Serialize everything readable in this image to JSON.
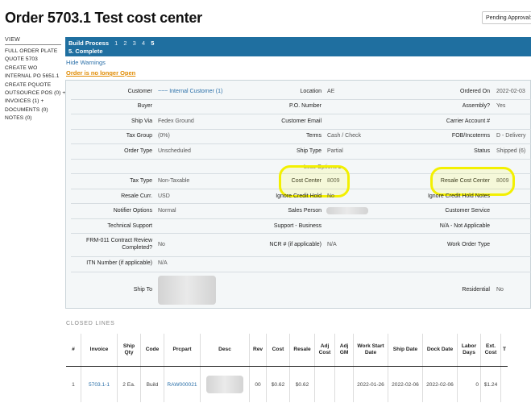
{
  "page_title": "Order 5703.1 Test cost center",
  "pending_approval": "Pending Approval:",
  "nav": {
    "view_label": "VIEW",
    "items": [
      "FULL ORDER PLATE",
      "QUOTE 5703",
      "CREATE WO",
      "INTERNAL PO 5651.1",
      "CREATE PQUOTE",
      "OUTSOURCE POS (0) +",
      "INVOICES (1) +",
      "DOCUMENTS (0)",
      "NOTES (0)"
    ]
  },
  "build_process": {
    "label": "Build Process",
    "steps": [
      "1",
      "2",
      "3",
      "4",
      "5"
    ],
    "active_step": "5",
    "current": "5. Complete",
    "color": "#1f6fa0"
  },
  "hide_warnings": "Hide Warnings",
  "warning_order_closed": "Order is no longer Open",
  "fields": {
    "customer_label": "Customer",
    "customer_value": "~~~ Internal Customer (1)",
    "location_label": "Location",
    "location_value": "AE",
    "ordered_on_label": "Ordered On",
    "ordered_on_value": "2022-02-03",
    "buyer_label": "Buyer",
    "po_number_label": "P.O. Number",
    "assembly_label": "Assembly?",
    "assembly_value": "Yes",
    "ship_via_label": "Ship Via",
    "ship_via_value": "Fedex Ground",
    "customer_email_label": "Customer Email",
    "carrier_account_label": "Carrier Account #",
    "tax_group_label": "Tax Group",
    "tax_group_value": "(0%)",
    "terms_label": "Terms",
    "terms_value": "Cash / Check",
    "fob_label": "FOB/Incoterms",
    "fob_value": "D - Delivery",
    "order_type_label": "Order Type",
    "order_type_value": "Unscheduled",
    "ship_type_label": "Ship Type",
    "ship_type_value": "Partial",
    "status_label": "Status",
    "status_value": "Shipped (6)",
    "less_options": "Less Options ▴",
    "tax_type_label": "Tax Type",
    "tax_type_value": "Non-Taxable",
    "cost_center_label": "Cost Center",
    "cost_center_value": "8009",
    "resale_cost_center_label": "Resale Cost Center",
    "resale_cost_center_value": "8009",
    "resale_curr_label": "Resale Curr.",
    "resale_curr_value": "USD",
    "ignore_credit_hold_label": "Ignore Credit Hold",
    "ignore_credit_hold_value": "No",
    "ignore_credit_hold_notes_label": "Ignore Credit Hold Notes",
    "notifier_options_label": "Notifier Options",
    "notifier_options_value": "Normal",
    "sales_person_label": "Sales Person",
    "customer_service_label": "Customer Service",
    "technical_support_label": "Technical Support",
    "support_business_label": "Support - Business",
    "na_not_applicable": "N/A - Not Applicable",
    "frm_label": "FRM-011 Contract Review Completed?",
    "frm_value": "No",
    "ncr_label": "NCR # (if applicable)",
    "ncr_value": "N/A",
    "work_order_type_label": "Work Order Type",
    "itn_label": "ITN Number (if applicable)",
    "itn_value": "N/A",
    "ship_to_label": "Ship To",
    "residential_label": "Residential",
    "residential_value": "No"
  },
  "closed_lines": {
    "title": "CLOSED LINES",
    "headers": {
      "num": "#",
      "invoice": "Invoice",
      "ship_qty": "Ship Qty",
      "code": "Code",
      "prcpart": "Prcpart",
      "desc": "Desc",
      "rev": "Rev",
      "cost": "Cost",
      "resale": "Resale",
      "adj_cost": "Adj Cost",
      "adj_gm": "Adj GM",
      "work_start_date": "Work Start Date",
      "ship_date": "Ship Date",
      "dock_date": "Dock Date",
      "labor_days": "Labor Days",
      "ext_cost": "Ext. Cost",
      "overflow": "T"
    },
    "rows": [
      {
        "num": "1",
        "invoice": "5703.1-1",
        "ship_qty": "2 Ea.",
        "code": "Build",
        "prcpart": "RAW000021",
        "rev": "00",
        "cost": "$0.62",
        "resale": "$0.62",
        "adj_cost": "",
        "adj_gm": "",
        "work_start_date": "2022-01-26",
        "ship_date": "2022-02-06",
        "dock_date": "2022-02-06",
        "labor_days": "0",
        "ext_cost": "$1.24"
      }
    ]
  },
  "colors": {
    "highlight": "#f3f000",
    "link": "#2a6fa8",
    "warning": "#e08a00"
  }
}
